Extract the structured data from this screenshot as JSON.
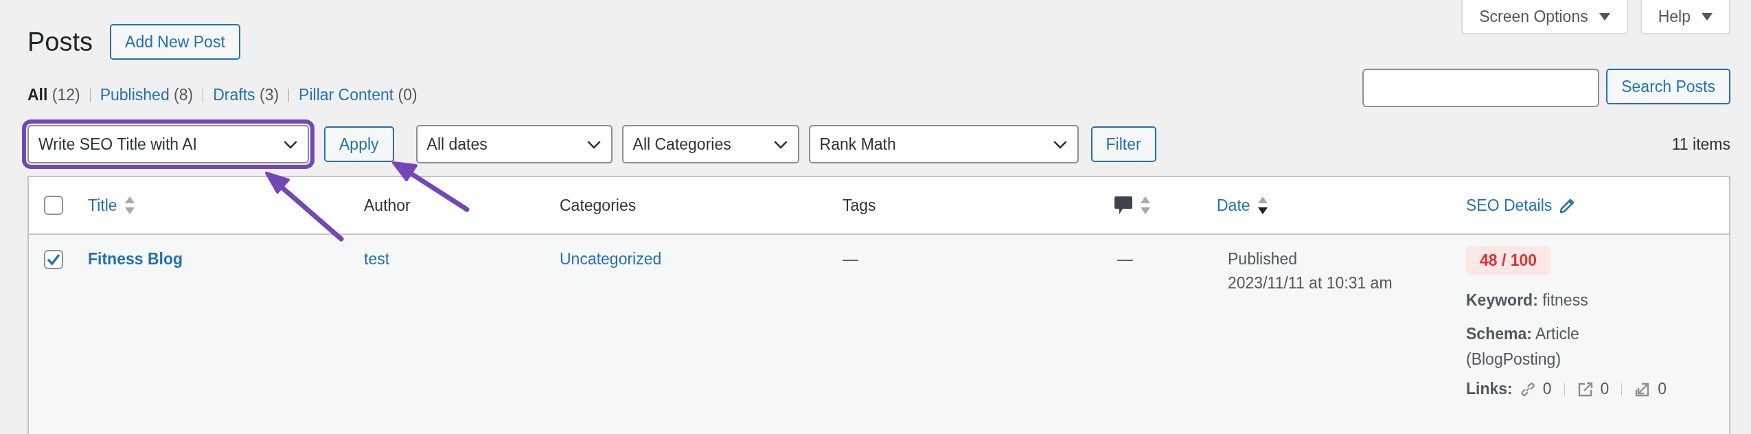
{
  "page_title": "Posts",
  "add_new": "Add New Post",
  "screen_meta": [
    {
      "label": "Screen Options"
    },
    {
      "label": "Help"
    }
  ],
  "views": [
    {
      "label": "All",
      "count": "(12)",
      "selected": true
    },
    {
      "label": "Published",
      "count": "(8)",
      "selected": false
    },
    {
      "label": "Drafts",
      "count": "(3)",
      "selected": false
    },
    {
      "label": "Pillar Content",
      "count": "(0)",
      "selected": false
    }
  ],
  "search": {
    "button": "Search Posts"
  },
  "bulk_action": {
    "value": "Write SEO Title with AI",
    "highlighted": true
  },
  "apply": "Apply",
  "filters": [
    {
      "value": "All dates"
    },
    {
      "value": "All Categories"
    },
    {
      "value": "Rank Math"
    }
  ],
  "filter_button": "Filter",
  "item_count": "11 items",
  "columns": [
    {
      "kind": "checkbox",
      "checked": false
    },
    {
      "kind": "sortable",
      "label": "Title",
      "sorted": false
    },
    {
      "kind": "plain",
      "label": "Author"
    },
    {
      "kind": "plain",
      "label": "Categories"
    },
    {
      "kind": "plain",
      "label": "Tags"
    },
    {
      "kind": "comments",
      "sorted": false
    },
    {
      "kind": "sortable",
      "label": "Date",
      "sorted": true
    },
    {
      "kind": "editable",
      "label": "SEO Details"
    }
  ],
  "rows": [
    {
      "checked": true,
      "title": "Fitness Blog",
      "author": "test",
      "categories": "Uncategorized",
      "tags": "—",
      "comments": "—",
      "date_status": "Published",
      "date": "2023/11/11 at 10:31 am",
      "seo": {
        "score": "48 / 100",
        "keyword": "**Keyword:** fitness",
        "schema": "**Schema:** Article (BlogPosting)",
        "links_label": "Links:",
        "links": [
          {
            "kind": "internal",
            "count": "0"
          },
          {
            "kind": "external",
            "count": "0"
          },
          {
            "kind": "incoming",
            "count": "0"
          }
        ]
      }
    }
  ]
}
